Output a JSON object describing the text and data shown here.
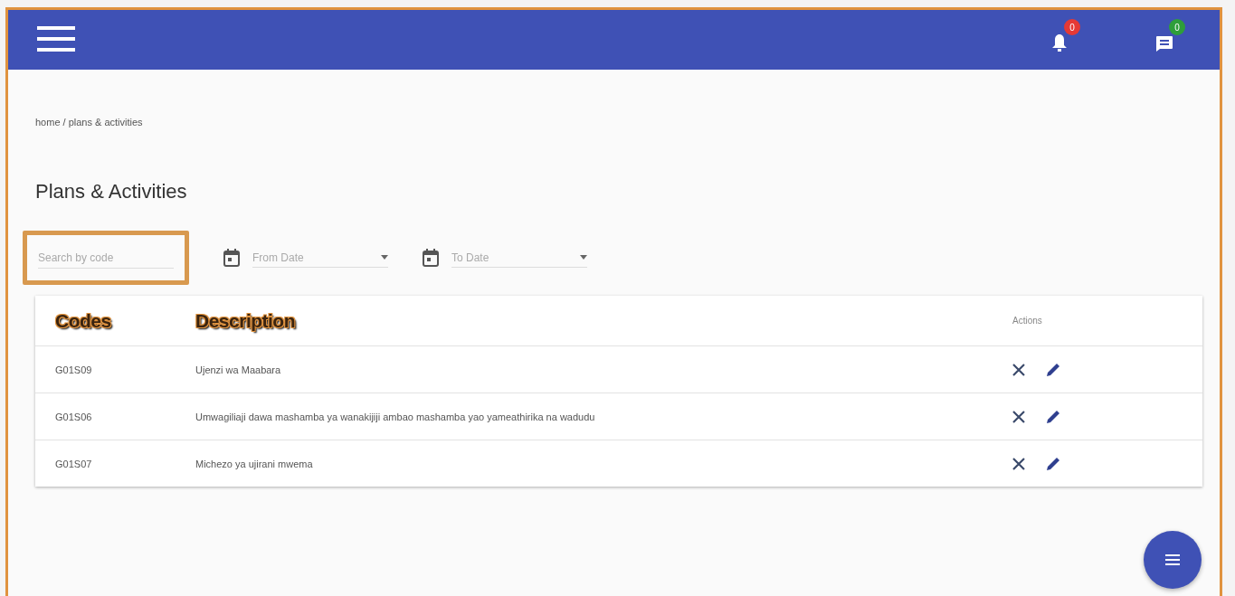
{
  "topbar": {
    "notifications": {
      "count": "0"
    },
    "messages": {
      "count": "0"
    }
  },
  "breadcrumb": "home / plans & activities",
  "title": "Plans & Activities",
  "filters": {
    "search": {
      "placeholder": "Search by code"
    },
    "from_date": {
      "placeholder": "From Date"
    },
    "to_date": {
      "placeholder": "To Date"
    }
  },
  "table": {
    "columns": [
      "Codes",
      "Description",
      "Actions"
    ],
    "rows": [
      {
        "code": "G01S09",
        "description": "Ujenzi wa Maabara"
      },
      {
        "code": "G01S06",
        "description": "Umwagiliaji dawa mashamba ya wanakijiji ambao mashamba yao yameathirika na wadudu"
      },
      {
        "code": "G01S07",
        "description": "Michezo ya ujirani mwema"
      }
    ]
  }
}
